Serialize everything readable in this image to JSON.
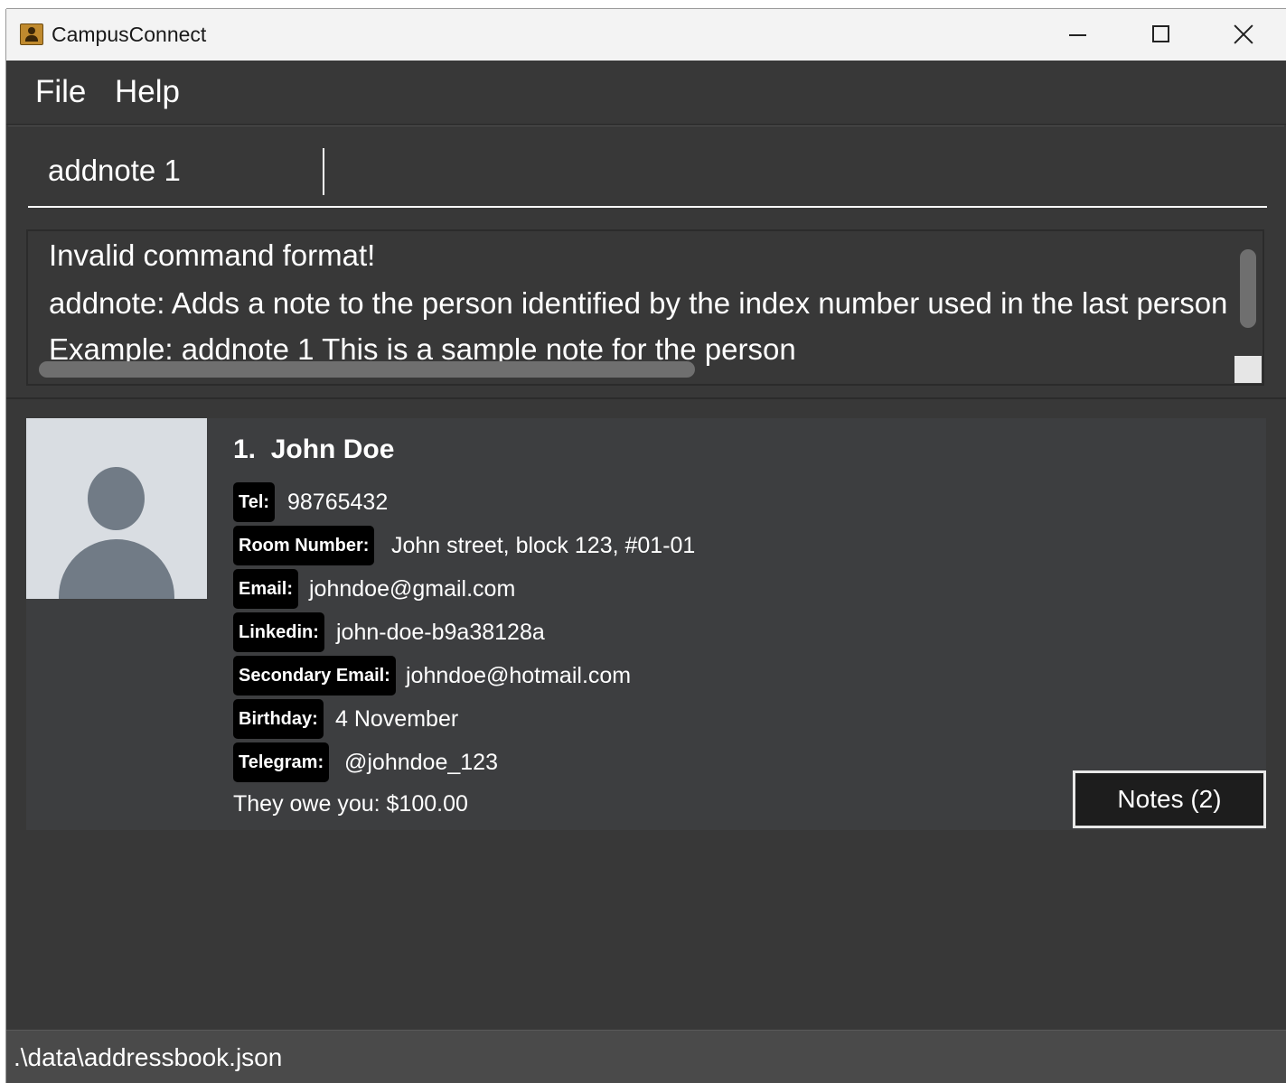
{
  "window": {
    "title": "CampusConnect"
  },
  "menu": {
    "file": "File",
    "help": "Help"
  },
  "command": {
    "value": "addnote 1"
  },
  "result": {
    "lines": [
      "Invalid command format!",
      "addnote: Adds a note to the person identified by the index number used in the last person",
      "Example: addnote 1 This is a sample note for the person"
    ]
  },
  "person": {
    "index": "1.",
    "name": "John Doe",
    "fields": [
      {
        "label": "Tel:",
        "value": "98765432"
      },
      {
        "label": "Room Number:",
        "value": "John street, block 123, #01-01"
      },
      {
        "label": "Email:",
        "value": "johndoe@gmail.com"
      },
      {
        "label": "Linkedin:",
        "value": "john-doe-b9a38128a"
      },
      {
        "label": "Secondary Email:",
        "value": "johndoe@hotmail.com"
      },
      {
        "label": "Birthday:",
        "value": "4 November"
      },
      {
        "label": "Telegram:",
        "value": "@johndoe_123"
      }
    ],
    "owe": "They owe you: $100.00",
    "notes_button": "Notes (2)"
  },
  "status": {
    "path": ".\\data\\addressbook.json"
  }
}
